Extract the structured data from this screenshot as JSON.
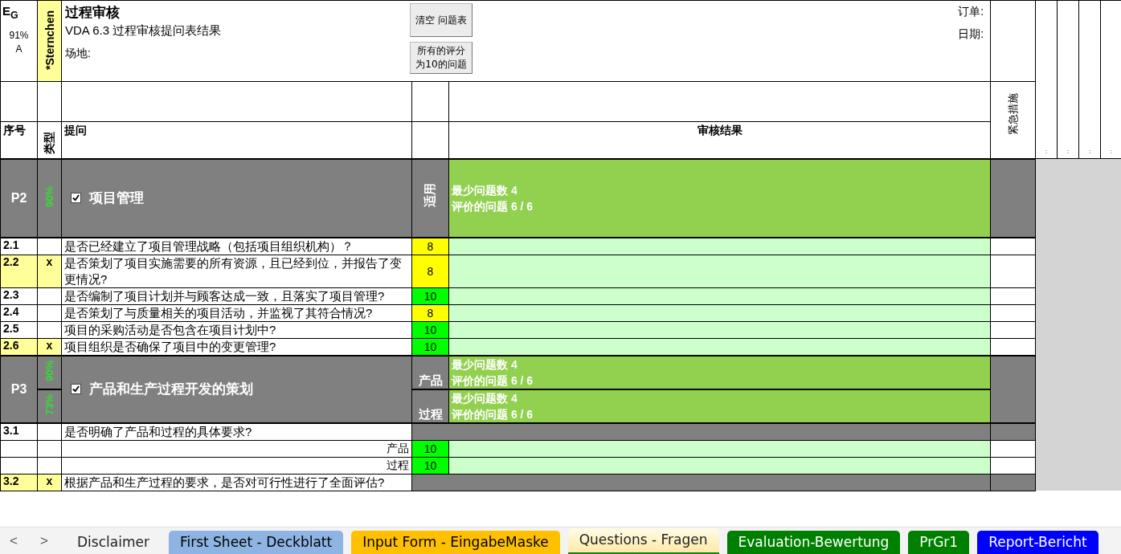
{
  "header": {
    "grade_label": "E$_{G}$",
    "score": "91%",
    "grade": "A",
    "sternchen": "*Sternchen",
    "title": "过程审核",
    "subtitle": "VDA 6.3 过程审核提问表结果",
    "site_label": "场地:",
    "order_label": "订单:",
    "date_label": "日期:",
    "buttons": [
      "清空 问题表",
      "所有的评分为10的问题"
    ]
  },
  "columns": {
    "seq": "序号",
    "type": "类型",
    "question": "提问",
    "result": "审核结果",
    "urgent": "紧急措施",
    "extra": [
      ":",
      ":",
      ":",
      ":"
    ]
  },
  "sections": [
    {
      "id": "P2",
      "checked": true,
      "title": "项目管理",
      "ratings": [
        {
          "percent": "90%",
          "label": "适用",
          "min": "最少问题数 4",
          "evaluated": "评价的问题 6 /  6"
        }
      ],
      "questions": [
        {
          "num": "2.1",
          "starred": false,
          "text": "是否已经建立了项目管理战略（包括项目组织机构）？",
          "scores": [
            {
              "value": "8",
              "color": "#ffff00"
            }
          ]
        },
        {
          "num": "2.2",
          "starred": true,
          "mark": "x",
          "text": "是否策划了项目实施需要的所有资源，且已经到位，并报告了变更情况?",
          "scores": [
            {
              "value": "8",
              "color": "#ffff00"
            }
          ]
        },
        {
          "num": "2.3",
          "starred": false,
          "text": "是否编制了项目计划并与顾客达成一致，且落实了项目管理?",
          "scores": [
            {
              "value": "10",
              "color": "#00ff00"
            }
          ]
        },
        {
          "num": "2.4",
          "starred": false,
          "text": "是否策划了与质量相关的项目活动，并监视了其符合情况?",
          "scores": [
            {
              "value": "8",
              "color": "#ffff00"
            }
          ]
        },
        {
          "num": "2.5",
          "starred": false,
          "text": "项目的采购活动是否包含在项目计划中?",
          "scores": [
            {
              "value": "10",
              "color": "#00ff00"
            }
          ]
        },
        {
          "num": "2.6",
          "starred": true,
          "mark": "x",
          "text": "项目组织是否确保了项目中的变更管理?",
          "scores": [
            {
              "value": "10",
              "color": "#00ff00"
            }
          ]
        }
      ]
    },
    {
      "id": "P3",
      "checked": true,
      "title": "产品和生产过程开发的策划",
      "ratings": [
        {
          "percent": "90%",
          "label": "产品",
          "min": "最少问题数 4",
          "evaluated": "评价的问题 6 /  6"
        },
        {
          "percent": "73%",
          "label": "过程",
          "min": "最少问题数 4",
          "evaluated": "评价的问题 6 /  6"
        }
      ],
      "questions": [
        {
          "num": "3.1",
          "starred": false,
          "text": "是否明确了产品和过程的具体要求?",
          "scores": [
            {
              "label": "产品",
              "value": "10",
              "color": "#00ff00"
            },
            {
              "label": "过程",
              "value": "10",
              "color": "#00ff00"
            }
          ]
        },
        {
          "num": "3.2",
          "starred": true,
          "mark": "x",
          "text": "根据产品和生产过程的要求，是否对可行性进行了全面评估?"
        }
      ]
    }
  ],
  "sheet_tabs": {
    "nav": [
      "<",
      ">"
    ],
    "tabs": [
      {
        "label": "Disclaimer",
        "selected": false
      },
      {
        "label": "First Sheet - Deckblatt",
        "selected": false,
        "color": "#8db4e2"
      },
      {
        "label": "Input Form - EingabeMaske",
        "selected": false,
        "color": "#ffc000"
      },
      {
        "label": "Questions - Fragen",
        "selected": true
      },
      {
        "label": "Evaluation-Bewertung",
        "selected": false,
        "color": "#008000"
      },
      {
        "label": "PrGr1",
        "selected": false,
        "color": "#008000"
      },
      {
        "label": "Report-Bericht",
        "selected": false,
        "color": "#0000ff"
      }
    ]
  }
}
